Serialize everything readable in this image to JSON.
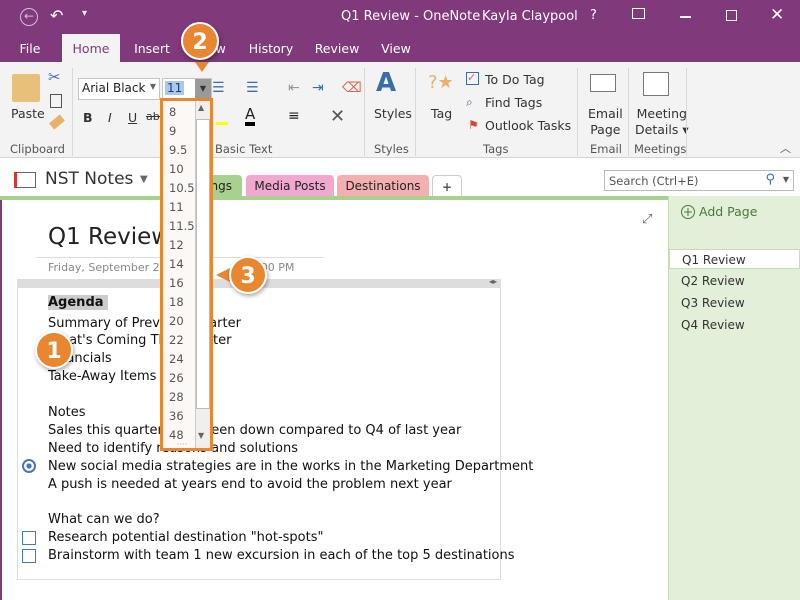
{
  "window": {
    "title": "Q1 Review - OneNote",
    "user": "Kayla Claypool",
    "help": "?"
  },
  "menu_tabs": [
    "File",
    "Home",
    "Insert",
    "View",
    "History",
    "Review",
    "View"
  ],
  "ribbon": {
    "clipboard": {
      "paste": "Paste",
      "group": "Clipboard"
    },
    "font": {
      "name": "Arial Black",
      "size": "11",
      "group": "Basic Text",
      "bold": "B",
      "italic": "I",
      "underline": "U",
      "strike": "abc"
    },
    "styles": {
      "label": "Styles",
      "group": "Styles"
    },
    "tags": {
      "tag": "Tag",
      "todo": "To Do Tag",
      "find": "Find Tags",
      "outlook": "Outlook Tasks",
      "group": "Tags"
    },
    "email": {
      "label1": "Email",
      "label2": "Page",
      "group": "Email"
    },
    "meetings": {
      "label1": "Meeting",
      "label2": "Details",
      "group": "Meetings"
    }
  },
  "font_sizes": [
    "8",
    "9",
    "9.5",
    "10",
    "10.5",
    "11",
    "11.5",
    "12",
    "14",
    "16",
    "18",
    "20",
    "22",
    "24",
    "26",
    "28",
    "36",
    "48"
  ],
  "notebook": {
    "name": "NST Notes",
    "sections": [
      "Meetings",
      "Media Posts",
      "Destinations",
      "+"
    ],
    "search_placeholder": "Search (Ctrl+E)"
  },
  "page": {
    "title": "Q1 Review",
    "date": "Friday, September 23",
    "time": "1:00 PM",
    "lines": [
      "Agenda",
      "Summary of Previous Quarter",
      "What's Coming This Quarter",
      "Financials",
      "Take-Away Items",
      "",
      "Notes",
      "Sales this quarter have been down compared to Q4 of last year",
      "Need to identify reasons and solutions",
      "New social media strategies are in the works in the Marketing Department",
      "A push is needed at years end to avoid the problem next year",
      "",
      "What can we do?",
      "Research potential destination \"hot-spots\"",
      "Brainstorm with team 1 new excursion in each of the top 5 destinations"
    ]
  },
  "page_list": {
    "add": "Add Page",
    "pages": [
      "Q1 Review",
      "Q2 Review",
      "Q3 Review",
      "Q4 Review"
    ]
  },
  "callouts": [
    "1",
    "2",
    "3"
  ],
  "colors": {
    "brand": "#80397B",
    "callout": "#E8872F",
    "section_green": "#a9d18e"
  }
}
